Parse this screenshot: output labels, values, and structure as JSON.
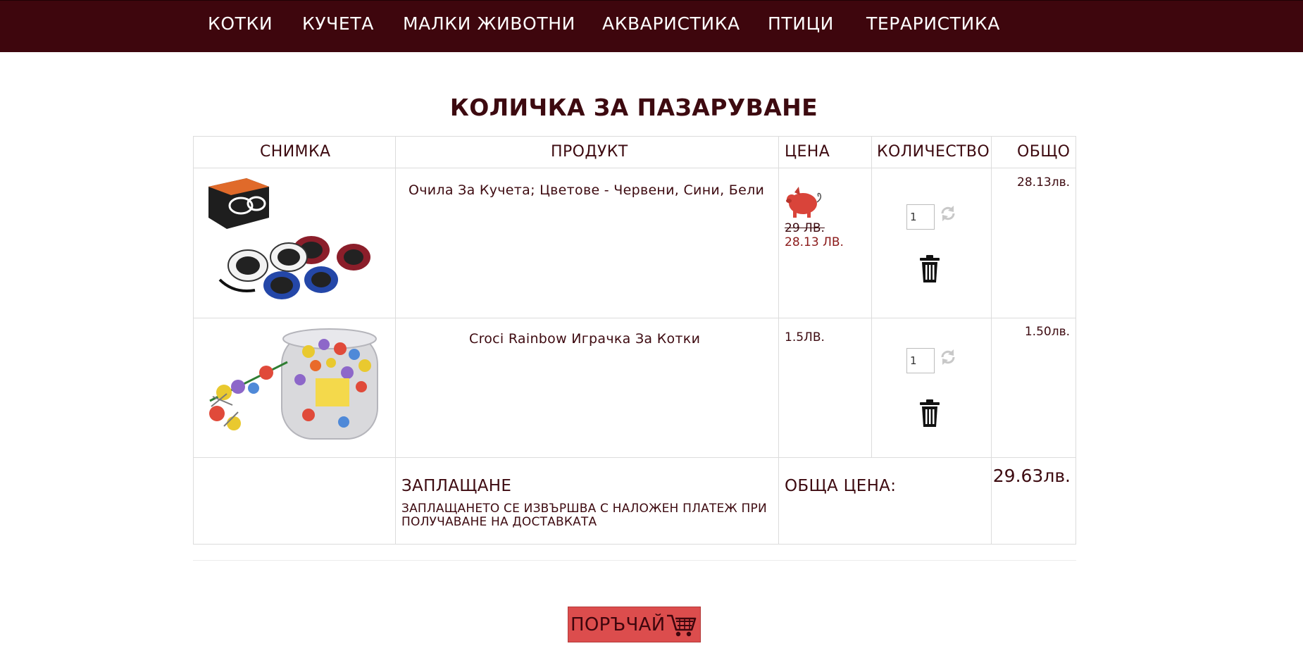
{
  "nav": {
    "items": [
      "КОТКИ",
      "КУЧЕТА",
      "МАЛКИ ЖИВОТНИ",
      "АКВАРИСТИКА",
      "ПТИЦИ",
      "ТЕРАРИСТИКА"
    ]
  },
  "page_title": "КОЛИЧКА ЗА ПАЗАРУВАНЕ",
  "table": {
    "headers": {
      "photo": "СНИМКА",
      "product": "ПРОДУКТ",
      "price": "ЦЕНА",
      "quantity": "КОЛИЧЕСТВО",
      "total": "ОБЩО"
    },
    "rows": [
      {
        "name": "Очила За Кучета; Цветове - Червени, Сини, Бели",
        "price_old": "29 ЛВ.",
        "price_new": "28.13 ЛВ.",
        "badge_icon": "pig-promo-icon",
        "quantity": "1",
        "total": "28.13лв."
      },
      {
        "name": "Croci Rainbow Играчка За Котки",
        "price": "1.5ЛВ.",
        "quantity": "1",
        "total": "1.50лв."
      }
    ]
  },
  "payment": {
    "title": "ЗАПЛАЩАНЕ",
    "text": "ЗАПЛАЩАНЕТО СЕ ИЗВЪРШВА С НАЛОЖЕН ПЛАТЕЖ ПРИ ПОЛУЧАВАНЕ НА ДОСТАВКАТА"
  },
  "summary": {
    "label": "ОБЩА ЦЕНА:",
    "value": "29.63лв."
  },
  "order_button": {
    "label": "ПОРЪЧАЙ",
    "icon": "shopping-cart-icon"
  },
  "colors": {
    "nav_background": "#3e060d",
    "text": "#3d0a10",
    "sale_price": "#8b1a1a",
    "order_button": "#dc4d4d"
  }
}
